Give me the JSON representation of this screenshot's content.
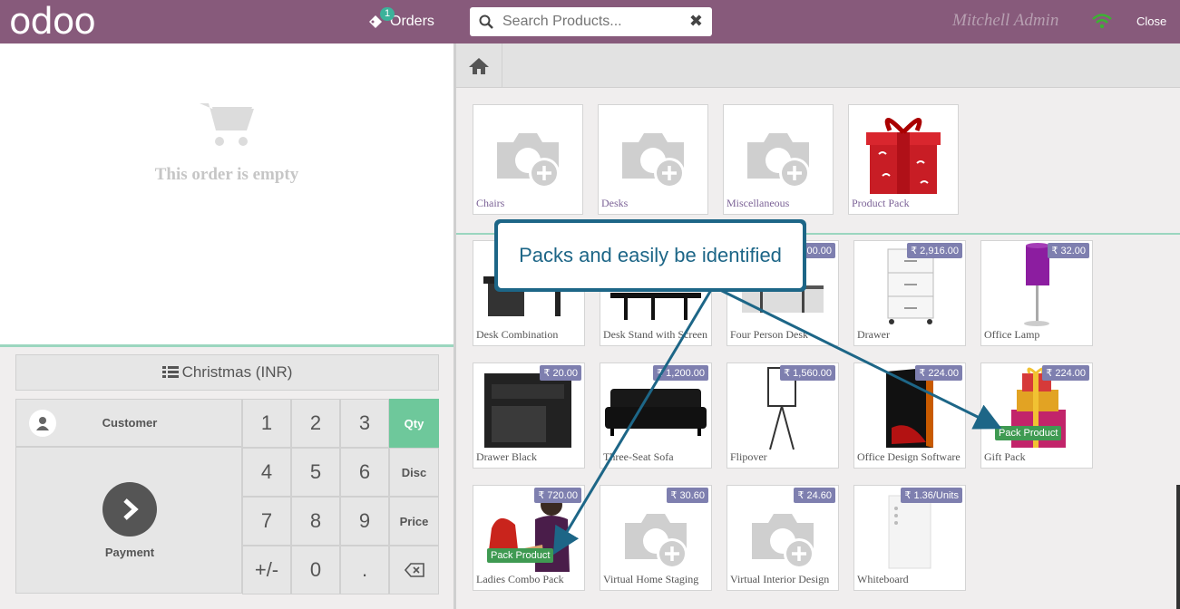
{
  "header": {
    "logo": "odoo",
    "orders_label": "Orders",
    "orders_count": "1",
    "search_placeholder": "Search Products...",
    "user": "Mitchell Admin",
    "close_label": "Close"
  },
  "order": {
    "empty_text": "This order is empty"
  },
  "pad": {
    "pricelist": "Christmas (INR)",
    "customer": "Customer",
    "payment": "Payment",
    "keys": [
      "1",
      "2",
      "3",
      "Qty",
      "4",
      "5",
      "6",
      "Disc",
      "7",
      "8",
      "9",
      "Price",
      "+/-",
      "0",
      "."
    ],
    "selected_mode": "Qty"
  },
  "categories": [
    {
      "name": "Chairs",
      "icon": "camera-plus-icon"
    },
    {
      "name": "Desks",
      "icon": "camera-plus-icon"
    },
    {
      "name": "Miscellaneous",
      "icon": "camera-plus-icon"
    },
    {
      "name": "Product Pack",
      "icon": "gift-box-icon"
    }
  ],
  "products": [
    {
      "name": "Desk Combination",
      "price": ""
    },
    {
      "name": "Desk Stand with Screen",
      "price": ""
    },
    {
      "name": "Four Person Desk",
      "price": "₹ 2,300.00"
    },
    {
      "name": "Drawer",
      "price": "₹ 2,916.00"
    },
    {
      "name": "Office Lamp",
      "price": "₹ 32.00"
    },
    {
      "name": "Drawer Black",
      "price": "₹ 20.00"
    },
    {
      "name": "Three-Seat Sofa",
      "price": "₹ 1,200.00"
    },
    {
      "name": "Flipover",
      "price": "₹ 1,560.00"
    },
    {
      "name": "Office Design Software",
      "price": "₹ 224.00"
    },
    {
      "name": "Gift Pack",
      "price": "₹ 224.00",
      "badge": "Pack Product"
    },
    {
      "name": "Ladies Combo Pack",
      "price": "₹ 720.00",
      "badge": "Pack Product"
    },
    {
      "name": "Virtual Home Staging",
      "price": "₹ 30.60"
    },
    {
      "name": "Virtual Interior Design",
      "price": "₹ 24.60"
    },
    {
      "name": "Whiteboard",
      "price": "₹ 1.36/Units"
    }
  ],
  "callout": {
    "text": "Packs and easily be identified"
  },
  "colors": {
    "topbar": "#875a7b",
    "accent": "#6ec89b",
    "price_tag": "#7e7faf",
    "pack_badge": "#3f9a52",
    "callout": "#1d6687"
  }
}
